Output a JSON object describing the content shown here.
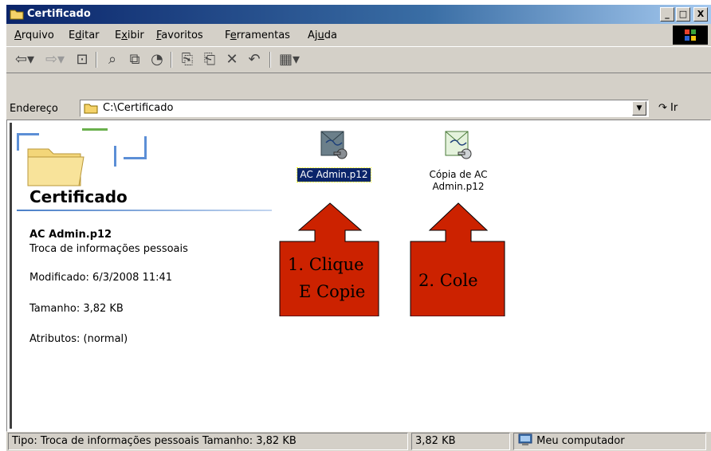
{
  "window": {
    "title": "Certificado",
    "minimize": "_",
    "maximize": "□",
    "close": "X"
  },
  "menu": [
    {
      "label": "Arquivo",
      "access": "A"
    },
    {
      "label": "Editar",
      "access": "d"
    },
    {
      "label": "Exibir",
      "access": "x"
    },
    {
      "label": "Favoritos",
      "access": "F"
    },
    {
      "label": "Ferramentas",
      "access": "e"
    },
    {
      "label": "Ajuda",
      "access": "u"
    }
  ],
  "address": {
    "label": "Endereço",
    "path": "C:\\Certificado",
    "go_label": "Ir"
  },
  "panel": {
    "title": "Certificado",
    "file_name": "AC Admin.p12",
    "file_type": "Troca de informações pessoais",
    "modified": "Modificado: 6/3/2008 11:41",
    "size": "Tamanho: 3,82 KB",
    "attributes": "Atributos: (normal)"
  },
  "files": [
    {
      "name": "AC Admin.p12",
      "selected": true
    },
    {
      "name": "Cópia de AC\nAdmin.p12",
      "selected": false
    }
  ],
  "callouts": {
    "first_line1": "1. Clique",
    "first_line2": "E Copie",
    "second": "2. Cole",
    "color": "#cc2200"
  },
  "status": {
    "details": "Tipo: Troca de informações pessoais Tamanho: 3,82 KB",
    "size": "3,82 KB",
    "zone": "Meu computador"
  },
  "colors": {
    "titlebar_start": "#0a246a",
    "selection": "#0a246a",
    "chrome": "#d4d0c8"
  }
}
